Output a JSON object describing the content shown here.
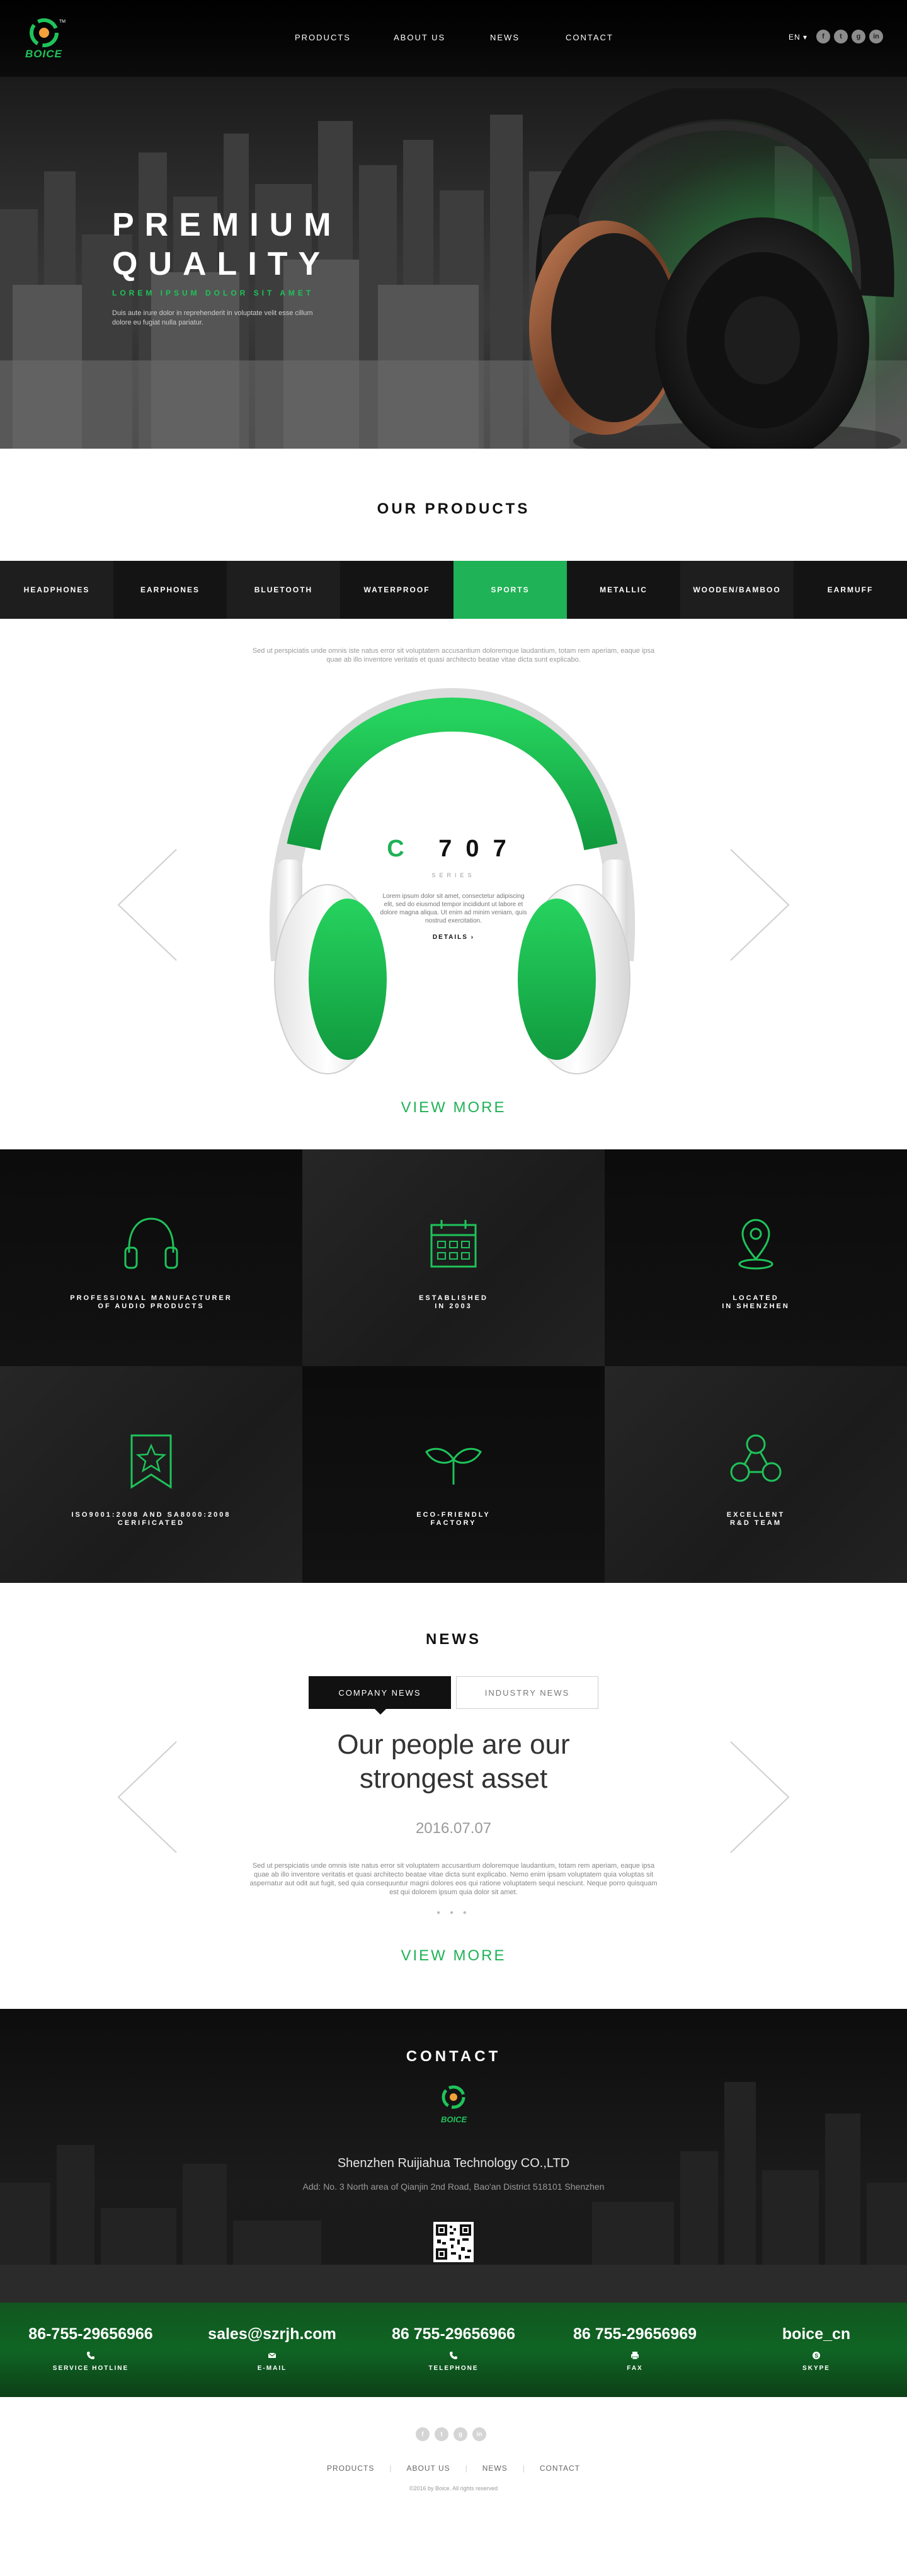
{
  "brand": {
    "logo_text": "BOICE",
    "tm": "TM"
  },
  "nav": {
    "items": [
      "PRODUCTS",
      "ABOUT US",
      "NEWS",
      "CONTACT"
    ],
    "lang": "EN ▾",
    "social": [
      "f",
      "t",
      "g",
      "in"
    ]
  },
  "hero": {
    "title_line1": "PREMIUM",
    "title_line2": "QUALITY",
    "subtitle": "LOREM IPSUM DOLOR SIT AMET",
    "description": "Duis aute irure dolor in reprehenderit in voluptate velit esse cillum dolore eu fugiat nulla pariatur."
  },
  "products": {
    "title": "OUR PRODUCTS",
    "categories": [
      "HEADPHONES",
      "EARPHONES",
      "BLUETOOTH",
      "WATERPROOF",
      "SPORTS",
      "METALLIC",
      "WOODEN/BAMBOO",
      "EARMUFF"
    ],
    "active_category": "SPORTS",
    "intro": "Sed ut perspiciatis unde omnis iste natus error sit voluptatem accusantium doloremque laudantium, totam rem aperiam, eaque ipsa quae ab illo inventore veritatis et quasi architecto beatae vitae dicta sunt explicabo.",
    "model_c": "C",
    "model_num": "707",
    "series": "SERIES",
    "model_desc": "Lorem ipsum dolor sit amet, consectetur adipiscing elit, sed do eiusmod tempor incididunt ut labore et dolore magna aliqua. Ut enim ad minim veniam, quis nostrud exercitation.",
    "details": "DETAILS ›",
    "view_more": "VIEW MORE",
    "accent_color": "#1fb256"
  },
  "features": [
    {
      "icon": "headphones-icon",
      "line1": "PROFESSIONAL MANUFACTURER",
      "line2": "OF AUDIO PRODUCTS"
    },
    {
      "icon": "calendar-icon",
      "line1": "ESTABLISHED",
      "line2": "IN 2003"
    },
    {
      "icon": "location-pin-icon",
      "line1": "LOCATED",
      "line2": "IN SHENZHEN"
    },
    {
      "icon": "certificate-star-icon",
      "line1": "ISO9001:2008 AND SA8000:2008",
      "line2": "CERIFICATED"
    },
    {
      "icon": "leaf-sprout-icon",
      "line1": "ECO-FRIENDLY",
      "line2": "FACTORY"
    },
    {
      "icon": "team-icon",
      "line1": "EXCELLENT",
      "line2": "R&D TEAM"
    }
  ],
  "news": {
    "title": "NEWS",
    "tabs": [
      "COMPANY NEWS",
      "INDUSTRY NEWS"
    ],
    "headline_line1": "Our people are our",
    "headline_line2": "strongest asset",
    "date": "2016.07.07",
    "body": "Sed ut perspiciatis unde omnis iste natus error sit voluptatem accusantium doloremque laudantium, totam rem aperiam, eaque ipsa quae ab illo inventore veritatis et quasi architecto beatae vitae dicta sunt explicabo. Nemo enim ipsam voluptatem quia voluptas sit aspernatur aut odit aut fugit, sed quia consequuntur magni dolores eos qui ratione voluptatem sequi nesciunt. Neque porro quisquam est qui dolorem ipsum quia dolor sit amet.",
    "dots": "● ● ●",
    "view_more": "VIEW MORE"
  },
  "contact": {
    "title": "CONTACT",
    "company": "Shenzhen Ruijiahua Technology CO.,LTD",
    "address": "Add: No. 3 North area of Qianjin 2nd Road, Bao'an District 518101 Shenzhen",
    "items": [
      {
        "value": "86-755-29656966",
        "label": "SERVICE HOTLINE",
        "icon": "phone-icon"
      },
      {
        "value": "sales@szrjh.com",
        "label": "E-MAIL",
        "icon": "mail-icon"
      },
      {
        "value": "86 755-29656966",
        "label": "TELEPHONE",
        "icon": "phone-icon"
      },
      {
        "value": "86 755-29656969",
        "label": "FAX",
        "icon": "fax-icon"
      },
      {
        "value": "boice_cn",
        "label": "SKYPE",
        "icon": "skype-icon"
      }
    ]
  },
  "footer": {
    "social": [
      "f",
      "t",
      "g",
      "in"
    ],
    "nav": [
      "PRODUCTS",
      "ABOUT US",
      "NEWS",
      "CONTACT"
    ],
    "copyright": "©2016 by Boice. All rights reserved"
  }
}
